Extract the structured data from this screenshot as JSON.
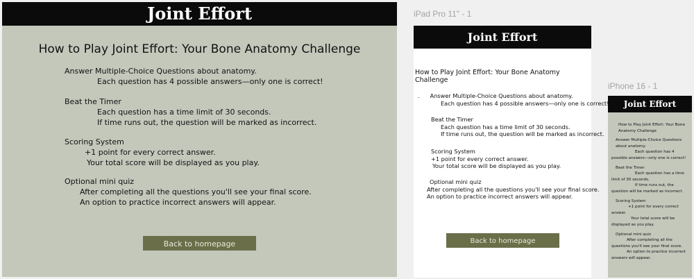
{
  "desktop": {
    "header_title": "Joint Effort",
    "page_title": "How to Play Joint Effort: Your Bone Anatomy Challenge",
    "sections": [
      {
        "heading": "Answer Multiple-Choice Questions about anatomy.",
        "lines": [
          "Each question has 4 possible answers—only one is correct!"
        ]
      },
      {
        "heading": "Beat the Timer",
        "lines": [
          "Each question has a time limit of 30 seconds.",
          "If time runs out, the question will be marked as incorrect."
        ]
      },
      {
        "heading": "Scoring System",
        "lines": [
          "+1 point for every correct answer.",
          "Your total score will be displayed as you play."
        ]
      },
      {
        "heading": "Optional mini quiz",
        "lines": [
          "After completing all the questions you'll see your final score.",
          "An option to practice incorrect answers will appear."
        ]
      }
    ],
    "back_button": "Back to homepage"
  },
  "ipad": {
    "frame_label": "iPad Pro 11\" - 1",
    "header_title": "Joint Effort",
    "page_title": "How to Play Joint Effort: Your Bone Anatomy Challenge",
    "bullet": ".",
    "sections": [
      {
        "heading": "Answer Multiple-Choice Questions about anatomy.",
        "lines": [
          "Each question has 4 possible answers—only one is correct!"
        ]
      },
      {
        "heading": "Beat the Timer",
        "lines": [
          "Each question has a time limit of 30 seconds.",
          "If time runs out, the question will be marked as incorrect."
        ]
      },
      {
        "heading": "Scoring System",
        "lines": [
          "+1 point for every correct answer.",
          "Your total score will be displayed as you play."
        ]
      },
      {
        "heading": "Optional mini quiz",
        "lines": [
          "After completing all the questions you'll see your final score.",
          "An option to practice incorrect answers will appear."
        ]
      }
    ],
    "back_button": "Back to homepage"
  },
  "iphone": {
    "frame_label": "iPhone 16 - 1",
    "header_title": "Joint Effort",
    "page_title": "How to Play Joint Effort: Your Bone Anatomy Challenge",
    "sections": [
      {
        "heading": "Answer Multiple-Choice Questions about anatomy.",
        "lines": [
          "Each question has 4 possible answers—only one is correct!"
        ]
      },
      {
        "heading": "Beat the Timer",
        "lines": [
          "Each question has a time limit of 30 seconds.",
          "If time runs out, the question will be marked as incorrect."
        ]
      },
      {
        "heading": "Scoring System",
        "lines": [
          "+1 point for every correct answer.",
          "Your total score will be displayed as you play."
        ]
      },
      {
        "heading": "Optional mini quiz",
        "lines": [
          "After completing all the questions you'll see your final score.",
          "An option to practice incorrect answers will appear."
        ]
      }
    ]
  },
  "colors": {
    "frame_bg": "#c4c8bb",
    "header_bg": "#0b0b0b",
    "button_bg": "#6a6f4a",
    "canvas_bg": "#f0f0f0"
  }
}
